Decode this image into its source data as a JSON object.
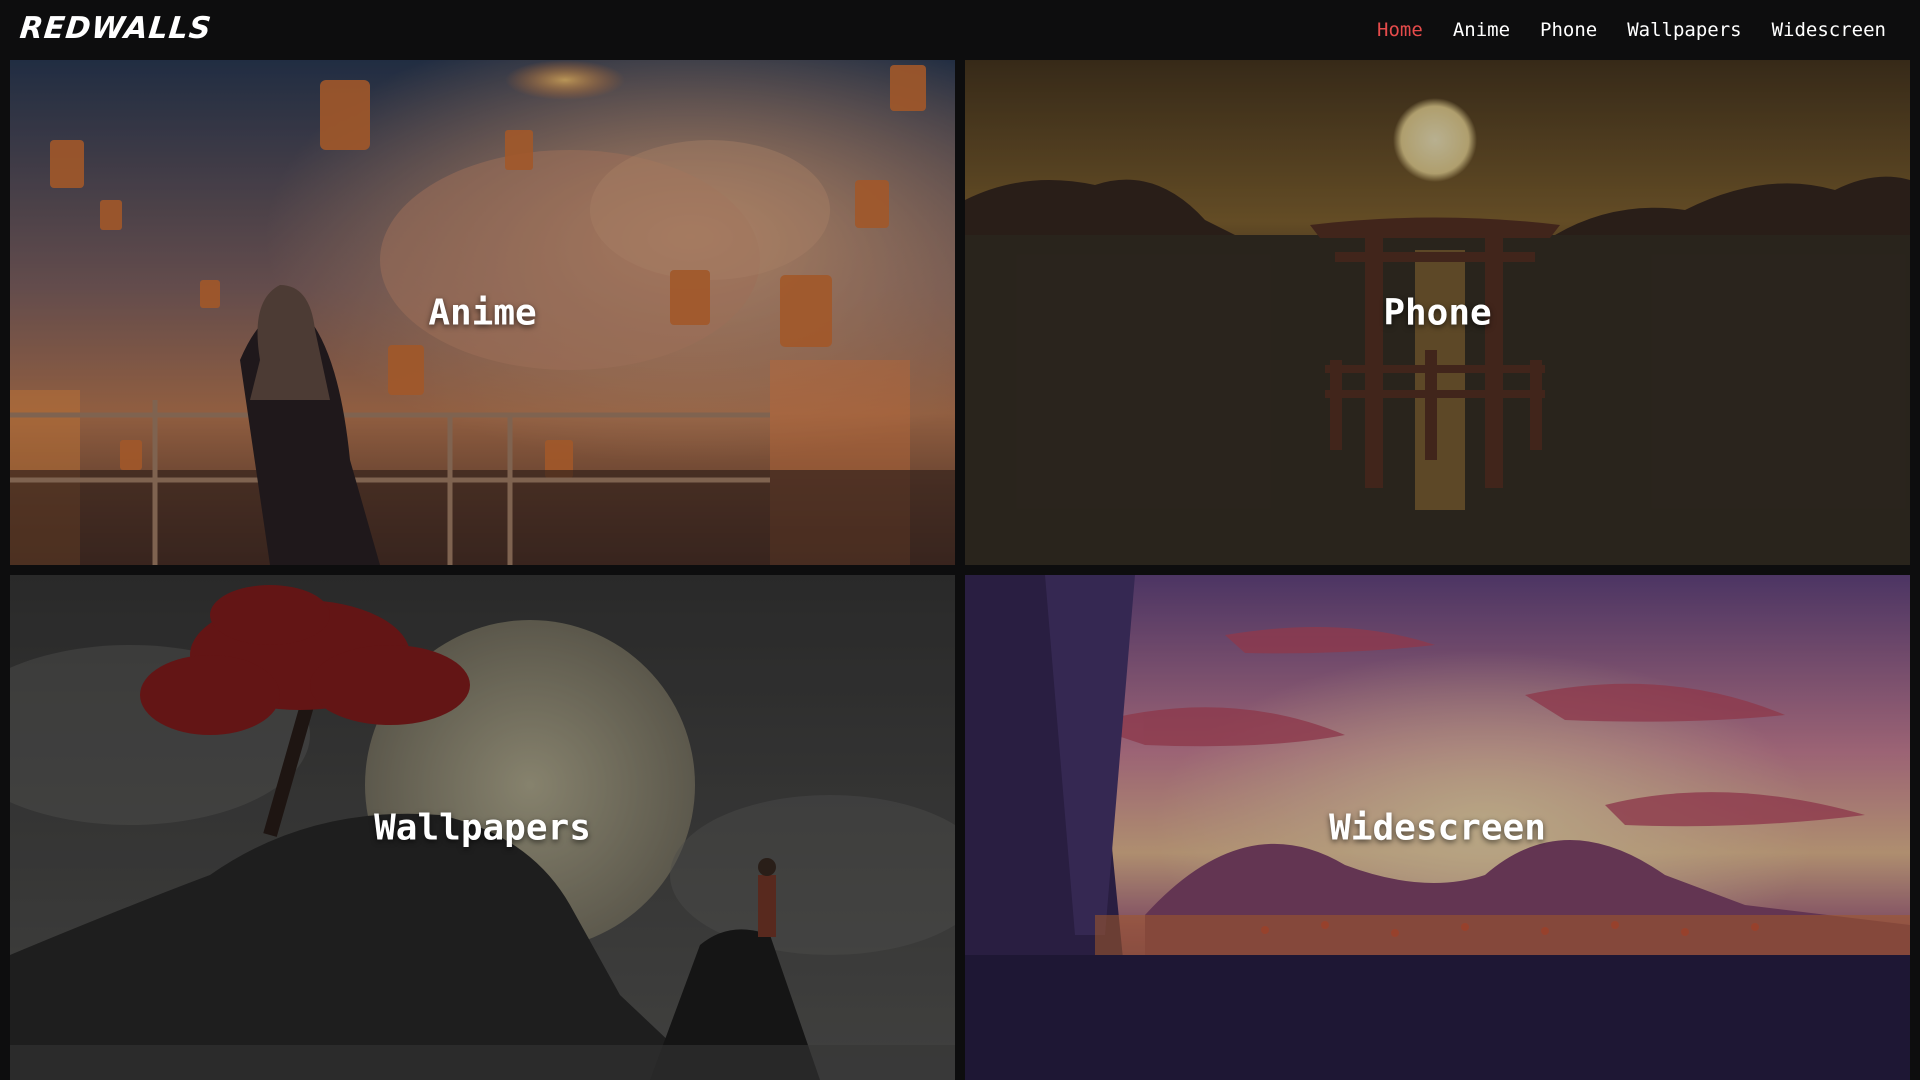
{
  "brand": {
    "logo_text": "REDWALLS"
  },
  "nav": {
    "items": [
      {
        "label": "Home",
        "active": true
      },
      {
        "label": "Anime",
        "active": false
      },
      {
        "label": "Phone",
        "active": false
      },
      {
        "label": "Wallpapers",
        "active": false
      },
      {
        "label": "Widescreen",
        "active": false
      }
    ],
    "active_color": "#e54b4b"
  },
  "tiles": [
    {
      "label": "Anime"
    },
    {
      "label": "Phone"
    },
    {
      "label": "Wallpapers"
    },
    {
      "label": "Widescreen"
    }
  ]
}
